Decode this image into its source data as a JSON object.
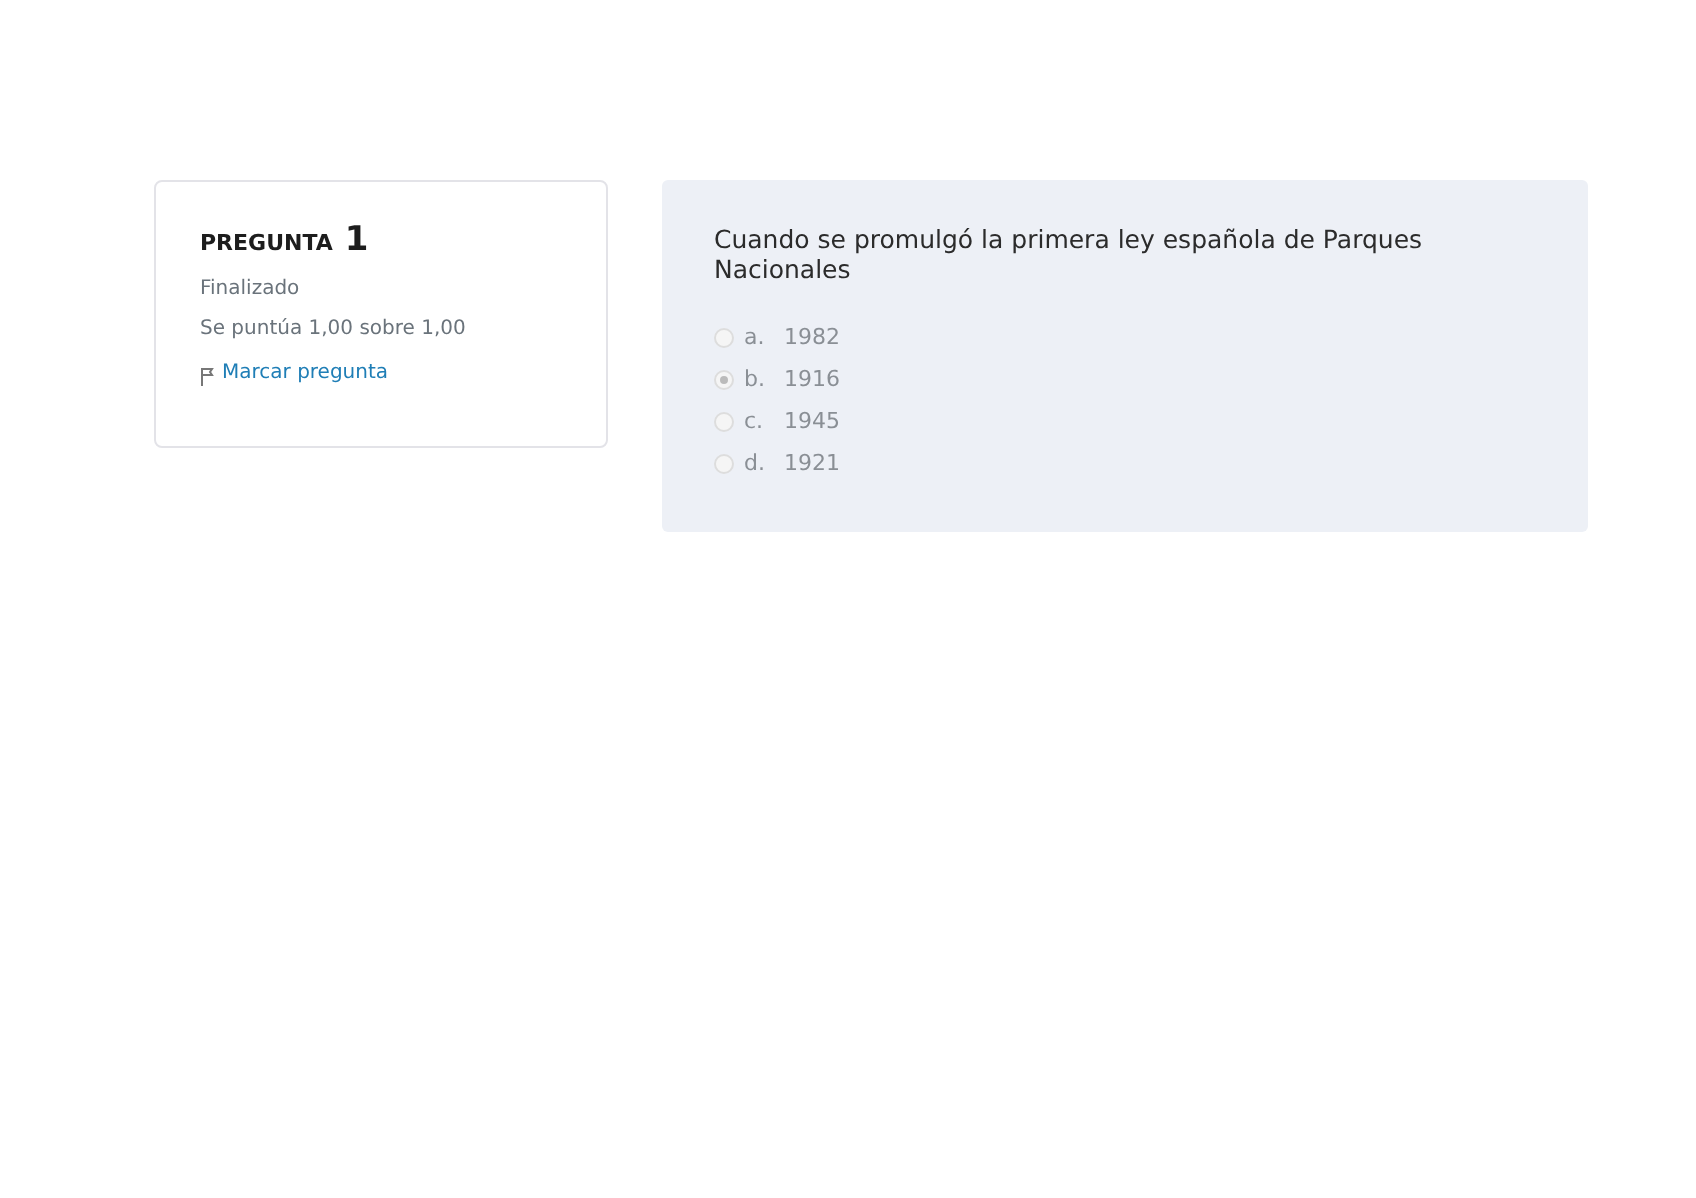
{
  "info": {
    "heading": "PREGUNTA",
    "number": "1",
    "state": "Finalizado",
    "grade": "Se puntúa 1,00 sobre 1,00",
    "flag_link": "Marcar pregunta"
  },
  "question": {
    "text": "Cuando se promulgó la primera ley española de Parques Nacionales",
    "options": [
      {
        "letter": "a.",
        "answer": "1982",
        "selected": false
      },
      {
        "letter": "b.",
        "answer": "1916",
        "selected": true
      },
      {
        "letter": "c.",
        "answer": "1945",
        "selected": false
      },
      {
        "letter": "d.",
        "answer": "1921",
        "selected": false
      }
    ]
  }
}
